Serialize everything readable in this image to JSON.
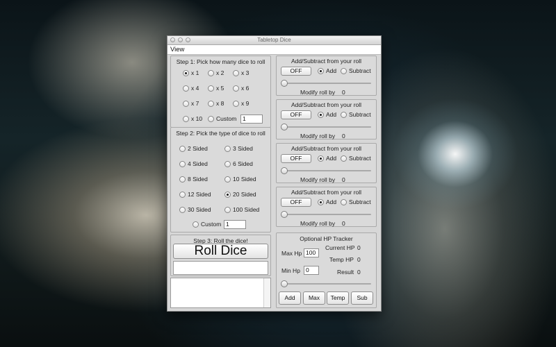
{
  "window": {
    "title": "Tabletop Dice",
    "menu": [
      "View"
    ]
  },
  "step1": {
    "title": "Step 1: Pick how many dice to roll",
    "options": [
      "x 1",
      "x 2",
      "x 3",
      "x 4",
      "x 5",
      "x 6",
      "x 7",
      "x 8",
      "x 9",
      "x 10",
      "Custom"
    ],
    "selected": "x 1",
    "custom_value": "1"
  },
  "step2": {
    "title": "Step 2: Pick the type of dice to roll",
    "options": [
      "2 Sided",
      "3 Sided",
      "4 Sided",
      "6 Sided",
      "8 Sided",
      "10 Sided",
      "12 Sided",
      "20 Sided",
      "30 Sided",
      "100 Sided",
      "Custom"
    ],
    "selected": "20 Sided",
    "custom_value": "1"
  },
  "step3": {
    "title": "Step 3: Roll the dice!",
    "roll_button": "Roll Dice",
    "result_text": "",
    "log_text": ""
  },
  "modifiers": [
    {
      "title": "Add/Subtract from your roll",
      "toggle": "OFF",
      "add": "Add",
      "subtract": "Subtract",
      "selected": "Add",
      "modify_label": "Modify roll by",
      "modify_value": "0",
      "slider_value": 0
    },
    {
      "title": "Add/Subtract from your roll",
      "toggle": "OFF",
      "add": "Add",
      "subtract": "Subtract",
      "selected": "Add",
      "modify_label": "Modify roll by",
      "modify_value": "0",
      "slider_value": 0
    },
    {
      "title": "Add/Subtract from your roll",
      "toggle": "OFF",
      "add": "Add",
      "subtract": "Subtract",
      "selected": "Add",
      "modify_label": "Modify roll by",
      "modify_value": "0",
      "slider_value": 0
    },
    {
      "title": "Add/Subtract from your roll",
      "toggle": "OFF",
      "add": "Add",
      "subtract": "Subtract",
      "selected": "Add",
      "modify_label": "Modify roll by",
      "modify_value": "0",
      "slider_value": 0
    }
  ],
  "hp": {
    "title": "Optional HP Tracker",
    "max_label": "Max Hp",
    "max_value": "100",
    "min_label": "Min Hp",
    "min_value": "0",
    "current_label": "Current HP",
    "current_value": "0",
    "temp_label": "Temp HP",
    "temp_value": "0",
    "result_label": "Result",
    "result_value": "0",
    "slider_value": 0,
    "buttons": [
      "Add",
      "Max",
      "Temp",
      "Sub"
    ]
  }
}
